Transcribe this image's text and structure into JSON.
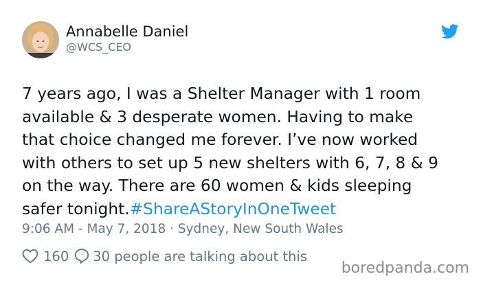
{
  "tweet": {
    "author_name": "Annabelle Daniel",
    "author_handle": "@WCS_CEO",
    "text_lines": [
      "7 years ago, I was a Shelter Manager with 1 room",
      "available & 3 desperate women. Having to make",
      "that choice changed me forever. I’ve now worked",
      "with others to set up 5 new shelters with 6, 7, 8 & 9",
      "on the way. There are 60 women & kids sleeping",
      "safer tonight."
    ],
    "hashtag": "#ShareAStoryInOneTweet",
    "timestamp": "9:06 AM - May 7, 2018 · Sydney, New South Wales",
    "like_count": "160",
    "reply_text": "30 people are talking about this"
  },
  "icons": {
    "logo": "twitter-bird-icon",
    "like": "heart-icon",
    "reply": "speech-bubble-icon"
  },
  "colors": {
    "hashtag": "#1b95e0",
    "twitter_blue": "#1da1f2",
    "secondary_text": "#657786"
  },
  "watermark": "boredpanda.com"
}
